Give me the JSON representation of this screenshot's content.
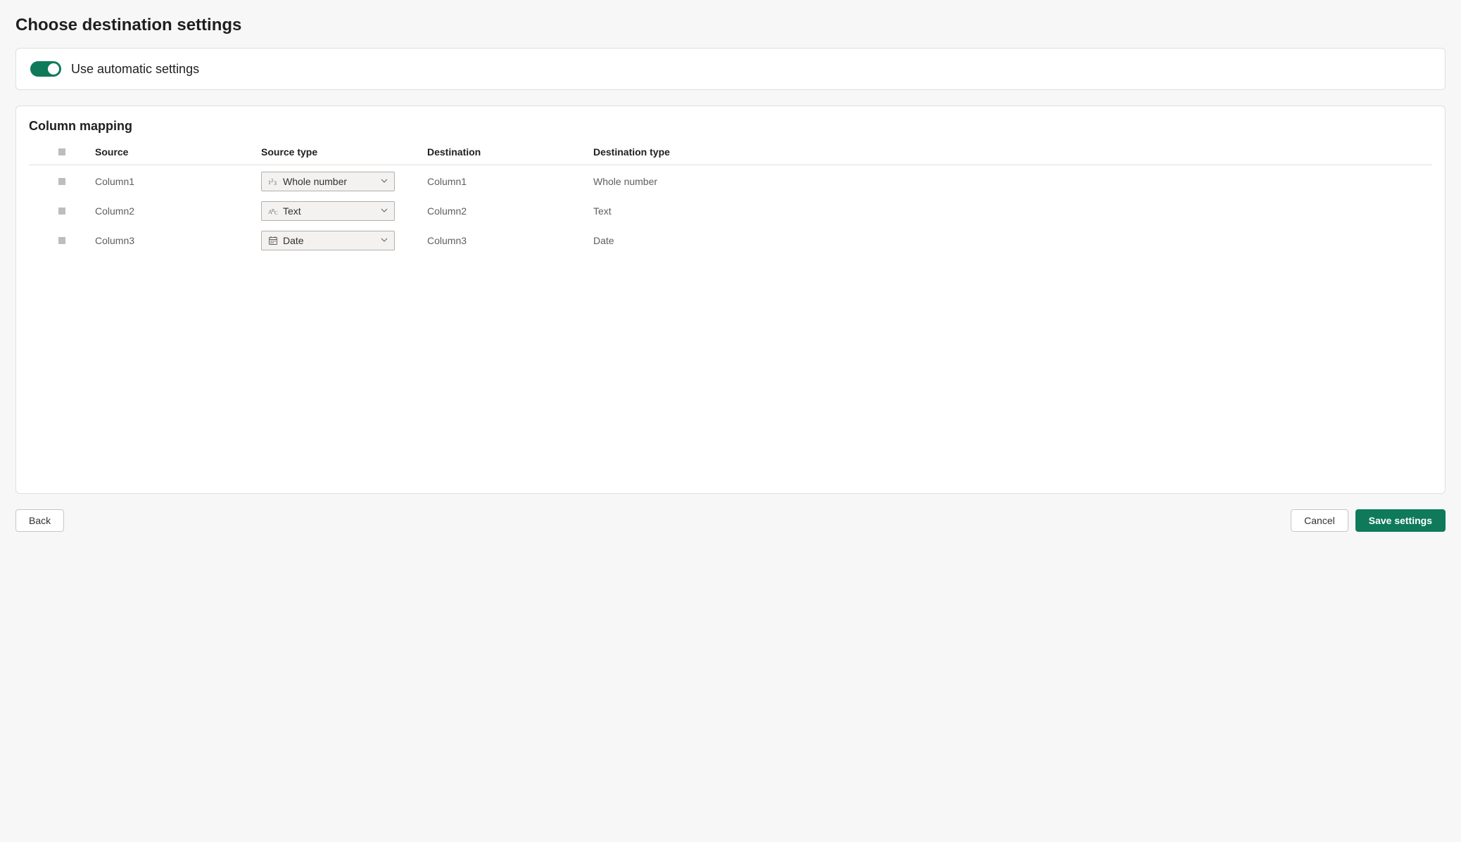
{
  "page_title": "Choose destination settings",
  "toggle": {
    "label": "Use automatic settings",
    "on": true
  },
  "mapping": {
    "title": "Column mapping",
    "headers": {
      "source": "Source",
      "source_type": "Source type",
      "destination": "Destination",
      "destination_type": "Destination type"
    },
    "rows": [
      {
        "source": "Column1",
        "source_type": "Whole number",
        "source_type_icon": "number",
        "destination": "Column1",
        "destination_type": "Whole number"
      },
      {
        "source": "Column2",
        "source_type": "Text",
        "source_type_icon": "text",
        "destination": "Column2",
        "destination_type": "Text"
      },
      {
        "source": "Column3",
        "source_type": "Date",
        "source_type_icon": "date",
        "destination": "Column3",
        "destination_type": "Date"
      }
    ]
  },
  "footer": {
    "back": "Back",
    "cancel": "Cancel",
    "save": "Save settings"
  }
}
